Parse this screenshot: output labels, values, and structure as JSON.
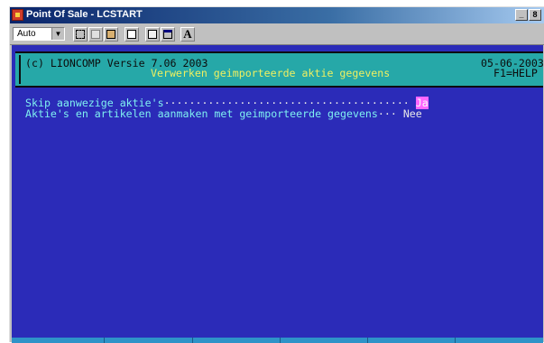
{
  "window": {
    "title": "Point Of Sale - LCSTART",
    "controls": {
      "minimize": "_",
      "restore": "8"
    }
  },
  "toolbar": {
    "font_select_value": "Auto",
    "font_button_label": "A",
    "icons": [
      "mark-icon",
      "copy-icon",
      "paste-icon",
      "fullscreen-icon",
      "properties-icon",
      "background-icon",
      "font-icon"
    ]
  },
  "header": {
    "copyright": "(c) LIONCOMP Versie 7.06 2003",
    "subtitle": "Verwerken geimporteerde aktie gegevens",
    "date": "05-06-2003",
    "help": "F1=HELP"
  },
  "form": {
    "fields": [
      {
        "label": "Skip aanwezige aktie's",
        "dots": "·······································",
        "value": "Ja"
      },
      {
        "label": "Aktie's en artikelen aanmaken met geimporteerde gegevens",
        "dots": "···",
        "value": "Nee"
      }
    ]
  },
  "colors": {
    "console_bg": "#2b2bb8",
    "header_bg": "#26a8a8",
    "highlight": "#ff66ff",
    "status_bar": "#2e93c8"
  }
}
